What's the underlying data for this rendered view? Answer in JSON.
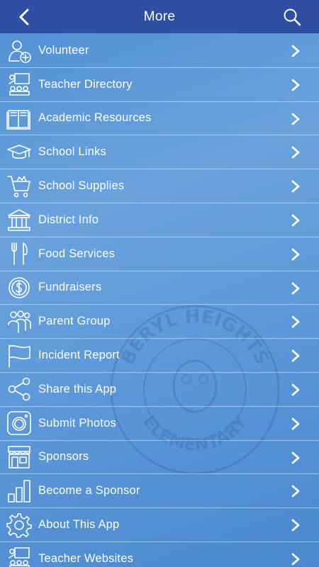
{
  "header": {
    "title": "More",
    "back_icon": "chevron-left-icon",
    "search_icon": "search-icon",
    "bg": "#2e4fa3"
  },
  "menu": [
    {
      "label": "Volunteer",
      "icon": "person-add-icon"
    },
    {
      "label": "Teacher Directory",
      "icon": "classroom-icon"
    },
    {
      "label": "Academic Resources",
      "icon": "book-icon"
    },
    {
      "label": "School Links",
      "icon": "graduation-cap-icon"
    },
    {
      "label": "School Supplies",
      "icon": "cart-icon"
    },
    {
      "label": "District Info",
      "icon": "building-icon"
    },
    {
      "label": "Food Services",
      "icon": "fork-knife-icon"
    },
    {
      "label": "Fundraisers",
      "icon": "coin-icon"
    },
    {
      "label": "Parent Group",
      "icon": "group-icon"
    },
    {
      "label": "Incident Report",
      "icon": "flag-icon"
    },
    {
      "label": "Share this App",
      "icon": "share-icon"
    },
    {
      "label": "Submit Photos",
      "icon": "camera-icon"
    },
    {
      "label": "Sponsors",
      "icon": "storefront-icon"
    },
    {
      "label": "Become a Sponsor",
      "icon": "bar-chart-icon"
    },
    {
      "label": "About This App",
      "icon": "gear-icon"
    },
    {
      "label": "Teacher Websites",
      "icon": "teacher-board-icon"
    }
  ],
  "watermark": {
    "top_text": "BERYL HEIGHTS",
    "bottom_text": "ELEMENTARY"
  }
}
